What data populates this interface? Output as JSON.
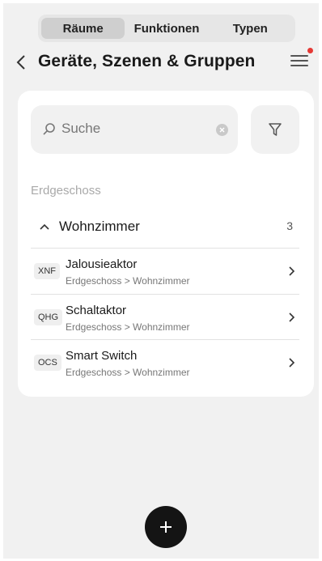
{
  "tabs": [
    {
      "label": "Räume",
      "active": true
    },
    {
      "label": "Funktionen",
      "active": false
    },
    {
      "label": "Typen",
      "active": false
    }
  ],
  "header": {
    "title": "Geräte, Szenen & Gruppen"
  },
  "search": {
    "placeholder": "Suche"
  },
  "floor": {
    "label": "Erdgeschoss"
  },
  "room": {
    "name": "Wohnzimmer",
    "count": "3"
  },
  "devices": [
    {
      "badge": "XNF",
      "name": "Jalousieaktor",
      "path": "Erdgeschoss > Wohnzimmer"
    },
    {
      "badge": "QHG",
      "name": "Schaltaktor",
      "path": "Erdgeschoss > Wohnzimmer"
    },
    {
      "badge": "OCS",
      "name": "Smart Switch",
      "path": "Erdgeschoss > Wohnzimmer"
    }
  ],
  "colors": {
    "background": "#f1f1f1",
    "card": "#ffffff",
    "fab": "#141414",
    "notification": "#e53935"
  }
}
